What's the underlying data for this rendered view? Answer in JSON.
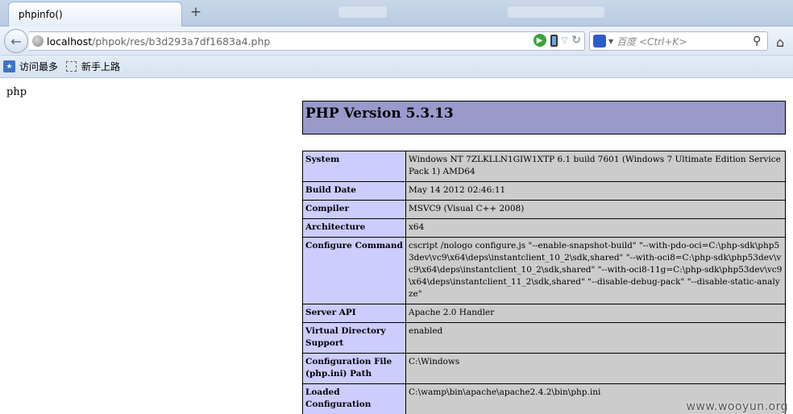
{
  "browser": {
    "tab_title": "phpinfo()",
    "new_tab_symbol": "+",
    "back_symbol": "←",
    "url_host": "localhost",
    "url_path": "/phpok/res/b3d293a7df1683a4.php",
    "search_placeholder": "百度 <Ctrl+K>",
    "bookmarks": [
      {
        "label": "访问最多"
      },
      {
        "label": "新手上路"
      }
    ],
    "icons": [
      "back-arrow-icon",
      "globe-icon",
      "go-icon",
      "phone-icon",
      "dropdown-icon",
      "reload-icon",
      "baidu-icon",
      "search-icon",
      "home-icon"
    ]
  },
  "page": {
    "intro_text": "php",
    "header_title": "PHP Version 5.3.13",
    "rows": [
      {
        "key": "System",
        "value": "Windows NT 7ZLKLLN1GIW1XTP 6.1 build 7601 (Windows 7 Ultimate Edition Service Pack 1) AMD64"
      },
      {
        "key": "Build Date",
        "value": "May 14 2012 02:46:11"
      },
      {
        "key": "Compiler",
        "value": "MSVC9 (Visual C++ 2008)"
      },
      {
        "key": "Architecture",
        "value": "x64"
      },
      {
        "key": "Configure Command",
        "value": "cscript /nologo configure.js \"--enable-snapshot-build\" \"--with-pdo-oci=C:\\php-sdk\\php53dev\\vc9\\x64\\deps\\instantclient_10_2\\sdk,shared\" \"--with-oci8=C:\\php-sdk\\php53dev\\vc9\\x64\\deps\\instantclient_10_2\\sdk,shared\" \"--with-oci8-11g=C:\\php-sdk\\php53dev\\vc9\\x64\\deps\\instantclient_11_2\\sdk,shared\" \"--disable-debug-pack\" \"--disable-static-analyze\""
      },
      {
        "key": "Server API",
        "value": "Apache 2.0 Handler"
      },
      {
        "key": "Virtual Directory Support",
        "value": "enabled"
      },
      {
        "key": "Configuration File (php.ini) Path",
        "value": "C:\\Windows"
      },
      {
        "key": "Loaded Configuration",
        "value": "C:\\wamp\\bin\\apache\\apache2.4.2\\bin\\php.ini"
      }
    ],
    "watermark": "www.wooyun.org"
  },
  "colors": {
    "header_bg": "#9999cc",
    "key_bg": "#ccccff",
    "value_bg": "#cccccc"
  }
}
